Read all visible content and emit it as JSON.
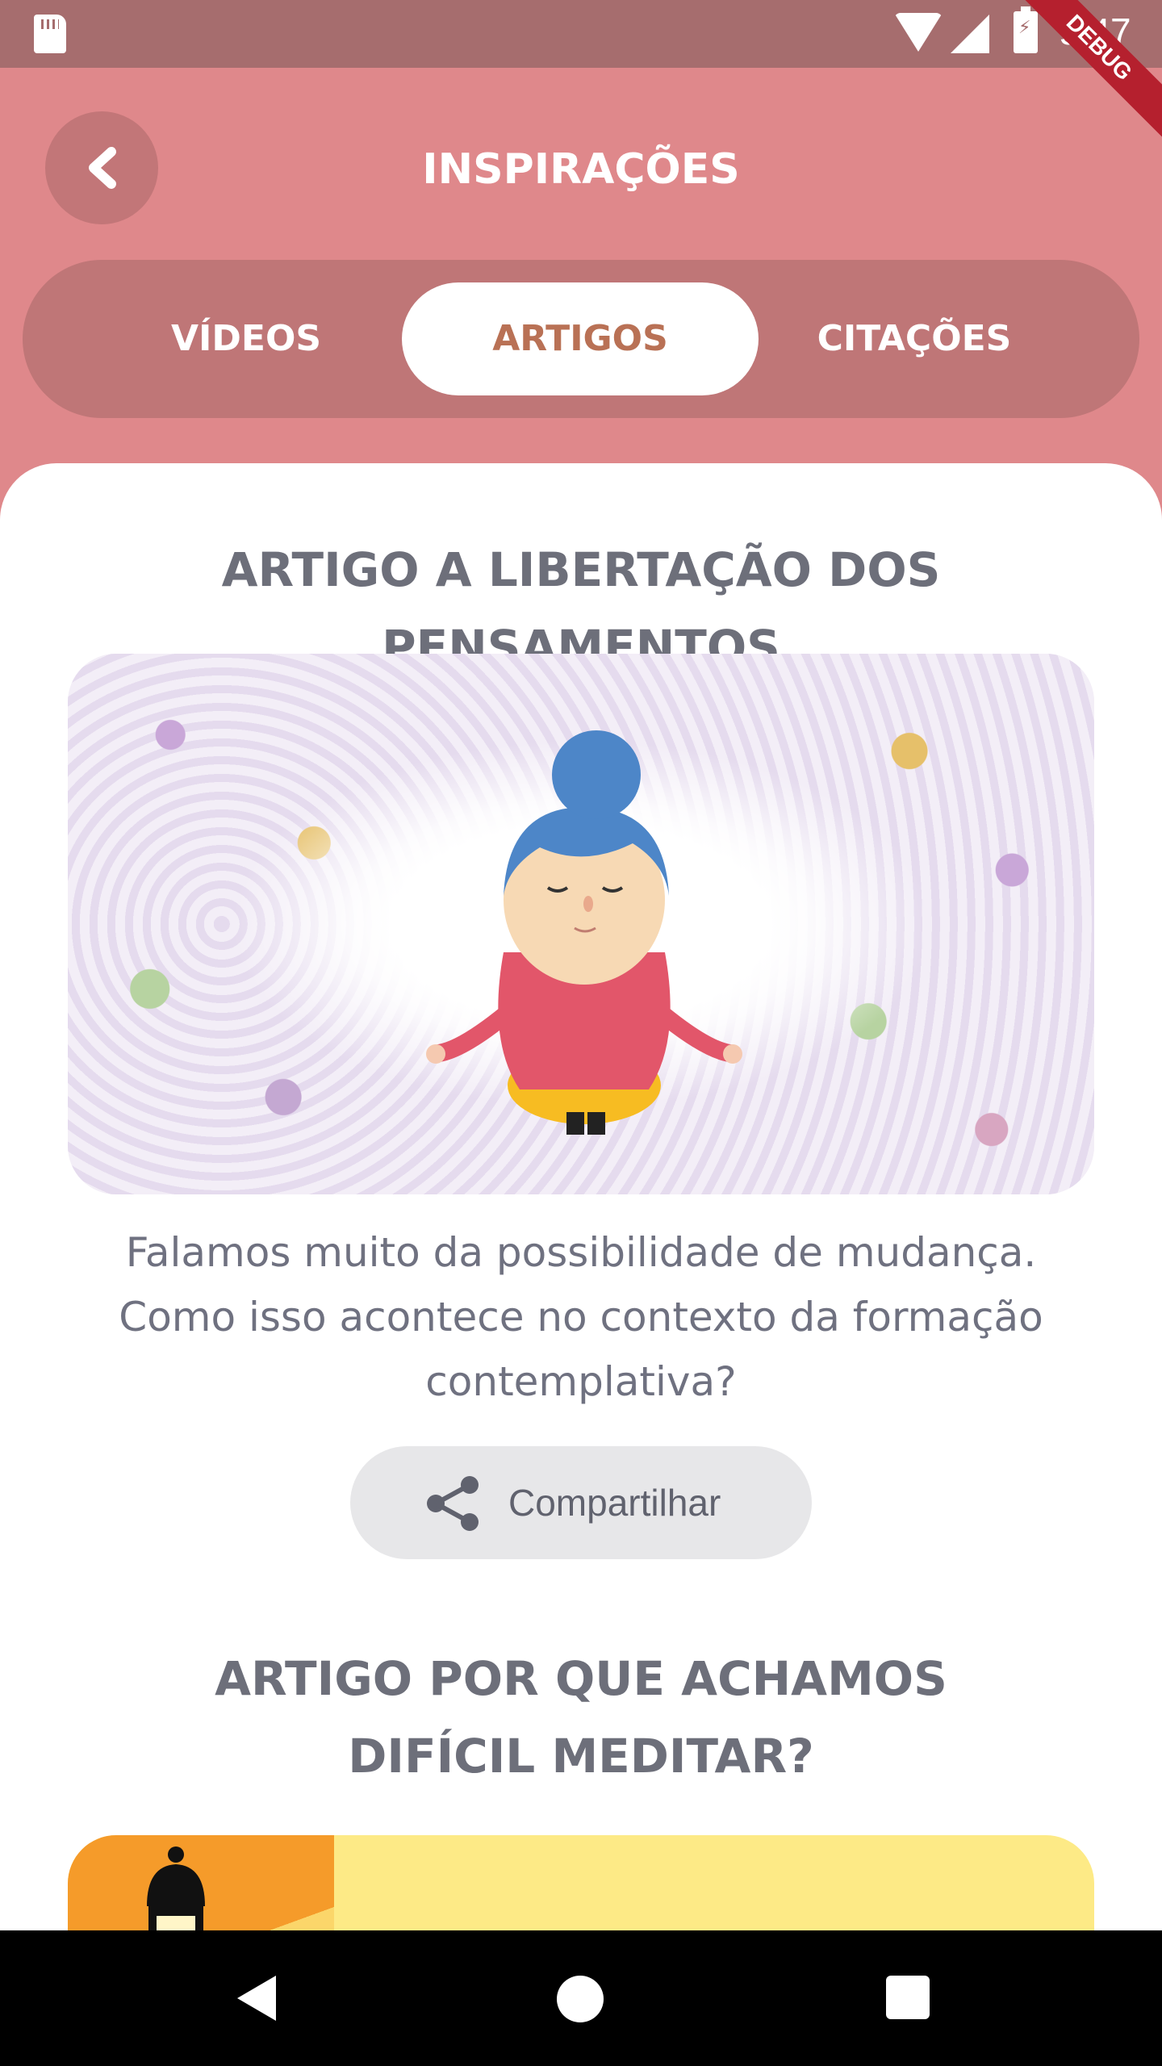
{
  "status_bar": {
    "time": "9:47",
    "debug_label": "DEBUG"
  },
  "header": {
    "title": "INSPIRAÇÕES"
  },
  "tabs": [
    {
      "label": "VÍDEOS",
      "active": false
    },
    {
      "label": "ARTIGOS",
      "active": true
    },
    {
      "label": "CITAÇÕES",
      "active": false
    }
  ],
  "articles": [
    {
      "title": "ARTIGO A LIBERTAÇÃO DOS PENSAMENTOS",
      "description": "Falamos muito da possibilidade de mudança. Como isso acontece no contexto da formação contemplativa?",
      "share_label": "Compartilhar",
      "image": "meditating-woman-illustration"
    },
    {
      "title": "ARTIGO POR QUE ACHAMOS DIFÍCIL MEDITAR?",
      "image": "lantern-illustration"
    }
  ],
  "colors": {
    "header_bg": "#df888b",
    "status_bar": "#a66d6e",
    "tab_bar": "#bf7677",
    "active_tab_text": "#b97155"
  },
  "nav_bar": {
    "icons": [
      "back-triangle-icon",
      "home-circle-icon",
      "recents-square-icon"
    ]
  }
}
